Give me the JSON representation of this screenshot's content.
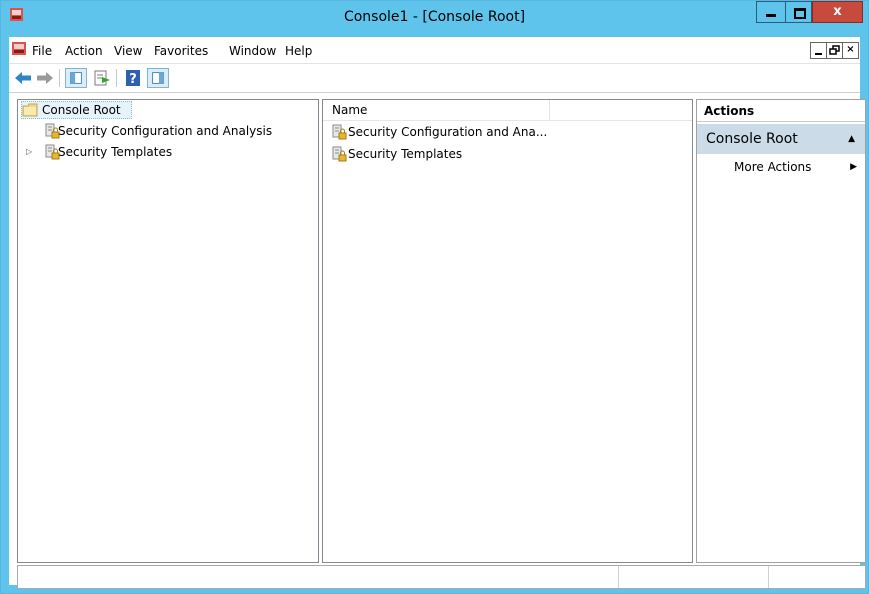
{
  "window": {
    "title": "Console1 - [Console Root]",
    "close_glyph": "x"
  },
  "menubar": {
    "items": [
      "File",
      "Action",
      "View",
      "Favorites",
      "Window",
      "Help"
    ],
    "mdi_restore_glyph": "²",
    "mdi_close_glyph": "×"
  },
  "toolbar": {
    "buttons": [
      "back-arrow-icon",
      "forward-arrow-icon",
      "show-hide-tree-icon",
      "export-list-icon",
      "help-icon",
      "show-hide-action-pane-icon"
    ]
  },
  "tree": {
    "root_label": "Console Root",
    "nodes": [
      {
        "label": "Security Configuration and Analysis",
        "expandable": false
      },
      {
        "label": "Security Templates",
        "expandable": true,
        "expander_glyph": "▷"
      }
    ]
  },
  "list": {
    "column_name": "Name",
    "rows": [
      "Security Configuration and Ana...",
      "Security Templates"
    ]
  },
  "actions": {
    "title": "Actions",
    "group_label": "Console Root",
    "collapse_glyph": "▲",
    "item": "More Actions",
    "item_arrow": "▶"
  },
  "colors": {
    "titlebar": "#5fc4ec",
    "close_button": "#c74a3d",
    "action_group": "#cbdbe7"
  }
}
